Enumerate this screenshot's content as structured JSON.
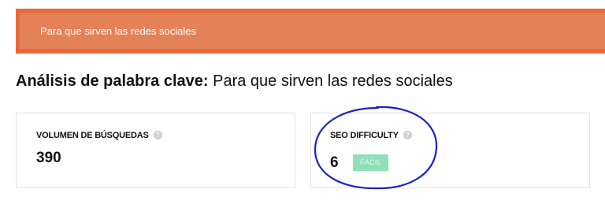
{
  "search": {
    "value": "Para que sirven las redes sociales"
  },
  "heading": {
    "prefix": "Análisis de palabra clave:",
    "keyword": "Para que sirven las redes sociales"
  },
  "metrics": {
    "search_volume": {
      "label": "VOLUMEN DE BÚSQUEDAS",
      "help": "?",
      "value": "390"
    },
    "seo_difficulty": {
      "label": "SEO DIFFICULTY",
      "help": "?",
      "value": "6",
      "badge": "FÁCIL"
    }
  },
  "colors": {
    "search_band": "#e8693f",
    "search_field": "#e58157",
    "badge_easy": "#8fe0b6",
    "annotation": "#1a23c9"
  },
  "icons": {
    "help": "help-circle-icon"
  }
}
